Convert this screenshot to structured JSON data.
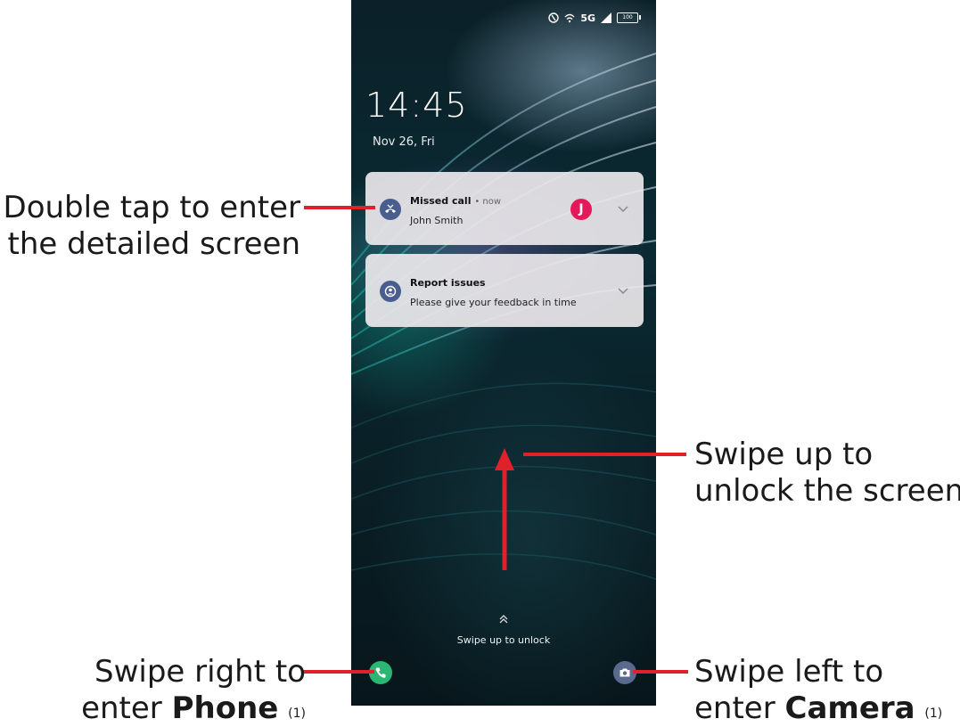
{
  "status_bar": {
    "network": "5G",
    "battery": "100"
  },
  "lockscreen": {
    "time": "14:45",
    "date": "Nov 26, Fri",
    "unlock_hint": "Swipe up to unlock"
  },
  "notifications": [
    {
      "title": "Missed call",
      "time": "now",
      "body": "John Smith",
      "avatar_letter": "J",
      "icon": "missed-call-icon"
    },
    {
      "title": "Report issues",
      "body": "Please give your feedback in time",
      "icon": "feedback-icon"
    }
  ],
  "callouts": {
    "double_tap": {
      "line1": "Double tap to enter",
      "line2": "the detailed screen"
    },
    "swipe_up": {
      "line1": "Swipe up to",
      "line2": "unlock the screen"
    },
    "phone": {
      "line1": "Swipe right to",
      "prefix": "enter",
      "bold": "Phone",
      "sup": "(1)"
    },
    "camera": {
      "line1": "Swipe left to",
      "prefix": "enter",
      "bold": "Camera",
      "sup": "(1)"
    }
  },
  "colors": {
    "annotation_line": "#e0202a",
    "phone_button": "#2bb673",
    "camera_button": "#5a6a8c",
    "avatar": "#e5195a"
  }
}
